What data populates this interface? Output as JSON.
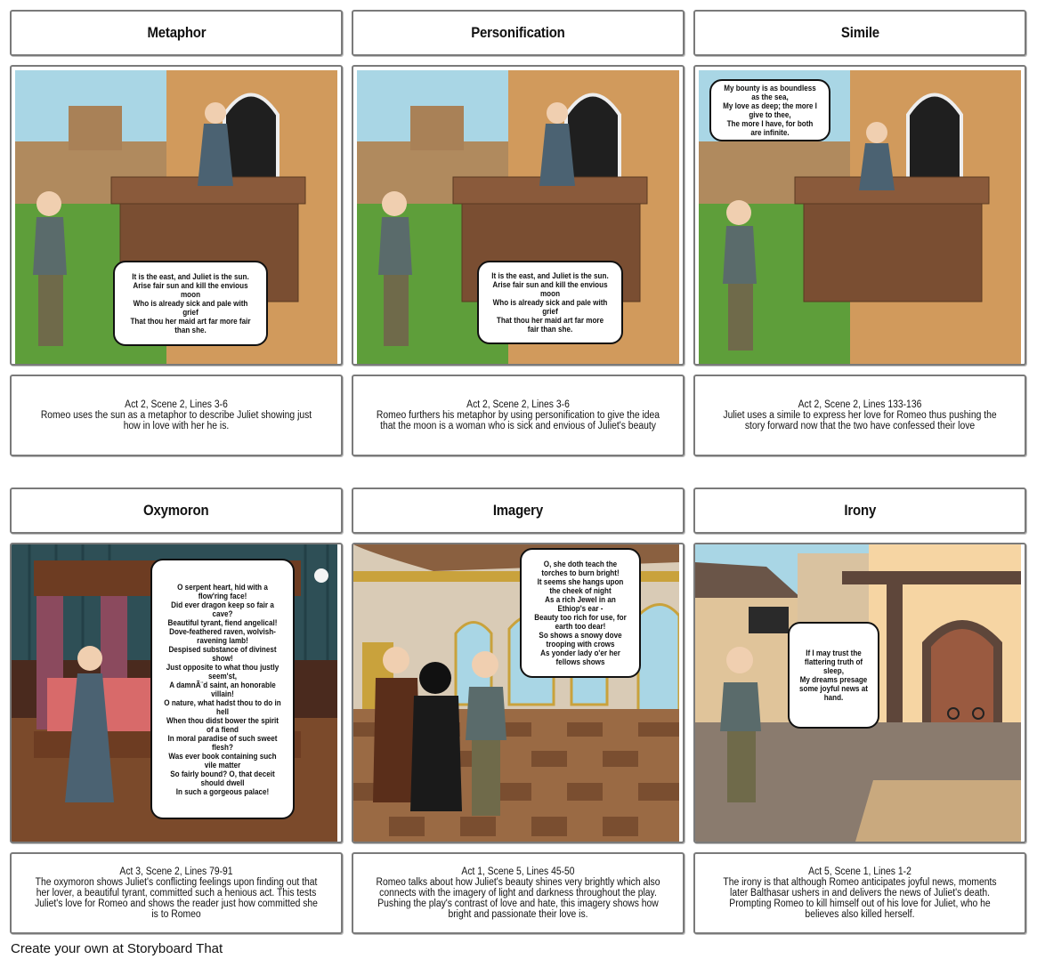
{
  "storyboard": {
    "panels": [
      {
        "title": "Metaphor",
        "bubble": "It is the east, and Juliet is the sun.\nArise fair sun and kill the envious moon\nWho is already sick and pale with grief\nThat thou her maid art far more fair than she.",
        "citation": "Act 2, Scene 2, Lines 3-6",
        "description": "Romeo uses the sun as a metaphor to describe Juliet showing just how in love with her he is."
      },
      {
        "title": "Personification",
        "bubble": "It is the east, and Juliet is the sun.\nArise fair sun and kill the envious moon\nWho is already sick and pale with grief\nThat thou her maid art far more fair than she.",
        "citation": "Act 2, Scene 2, Lines 3-6",
        "description": "Romeo furthers his metaphor by using personification to give the idea that the moon is a woman who is sick and envious of Juliet's beauty"
      },
      {
        "title": "Simile",
        "bubble": "My bounty is as boundless as the sea,\nMy love as deep; the more I give to thee,\nThe more I have, for both are infinite.",
        "citation": "Act 2, Scene 2, Lines 133-136",
        "description": "Juliet uses a simile to express her love for Romeo thus pushing the story forward now that the two have confessed their love"
      },
      {
        "title": "Oxymoron",
        "bubble": "O serpent heart, hid with a flow'ring face!\nDid ever dragon keep so fair a cave?\nBeautiful tyrant, fiend angelical!\nDove-feathered raven, wolvish-ravening lamb!\nDespised substance of divinest show!\nJust opposite to what thou justly seem'st,\nA damnÃ¨d saint, an honorable villain!\nO nature, what hadst thou to do in hell\nWhen thou didst bower the spirit of a fiend\nIn moral paradise of such sweet flesh?\nWas ever book containing such vile matter\nSo fairly bound? O, that deceit should dwell\nIn such a gorgeous palace!",
        "citation": "Act 3, Scene 2, Lines 79-91",
        "description": "The oxymoron shows Juliet's conflicting feelings upon finding out that her lover, a beautiful tyrant, committed such a henious act. This tests Juliet's love for Romeo and shows the reader just how committed she is to Romeo"
      },
      {
        "title": "Imagery",
        "bubble": "O, she doth teach the torches to burn bright!\nIt seems she hangs upon the cheek of night\nAs a rich Jewel in an Ethiop's ear -\nBeauty too rich for use, for earth too dear!\nSo shows a snowy dove trooping with crows\nAs yonder lady o'er her fellows shows",
        "citation": "Act 1, Scene 5, Lines 45-50",
        "description": "Romeo talks about how Juliet's beauty shines very brightly which also connects with the imagery of light and darkness throughout the play. Pushing the play's contrast of love  and hate, this imagery shows how bright and passionate their love is."
      },
      {
        "title": "Irony",
        "bubble": "If I may trust the flattering truth of sleep,\nMy dreams presage some joyful news at hand.",
        "citation": "Act 5, Scene 1, Lines 1-2",
        "description": "The irony is that although Romeo anticipates joyful news, moments later Balthasar ushers in and delivers the news of Juliet's death. Prompting Romeo to kill himself out of his love for Juliet, who he believes also killed herself."
      }
    ]
  },
  "footer": {
    "text": "Create your own at Storyboard That"
  },
  "colors": {
    "border": "#7a7a7a",
    "sky": "#a9d6e5",
    "grass": "#5e9e3a",
    "wall": "#d19a5c",
    "balcony": "#8a5a3b"
  }
}
